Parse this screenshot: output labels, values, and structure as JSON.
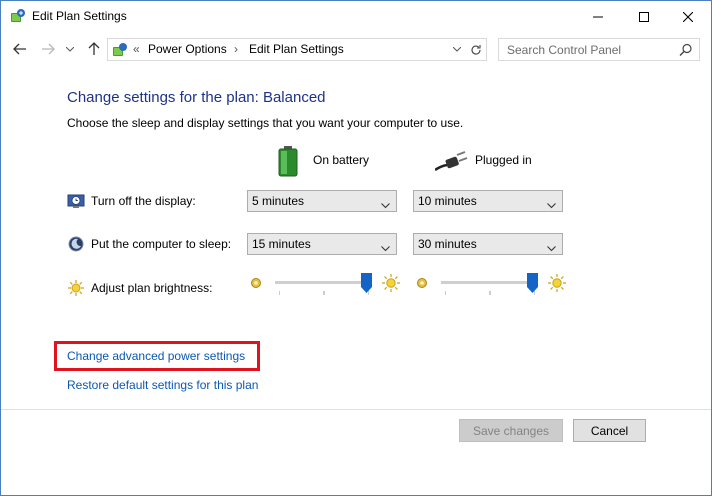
{
  "window": {
    "title": "Edit Plan Settings",
    "controls": {
      "minimize": "—",
      "maximize": "☐",
      "close": "✕"
    }
  },
  "navigation": {
    "breadcrumbs": [
      "«",
      "Power Options",
      "Edit Plan Settings"
    ],
    "chevron": "›",
    "search_placeholder": "Search Control Panel"
  },
  "plan": {
    "title": "Change settings for the plan: Balanced",
    "description": "Choose the sleep and display settings that you want your computer to use."
  },
  "columns": {
    "on_battery": "On battery",
    "plugged_in": "Plugged in"
  },
  "settings": {
    "display": {
      "label": "Turn off the display:",
      "on_battery": "5 minutes",
      "plugged_in": "10 minutes"
    },
    "sleep": {
      "label": "Put the computer to sleep:",
      "on_battery": "15 minutes",
      "plugged_in": "30 minutes"
    },
    "brightness": {
      "label": "Adjust plan brightness:",
      "on_battery_level": 1.0,
      "plugged_in_level": 1.0
    }
  },
  "links": {
    "advanced": "Change advanced power settings",
    "restore": "Restore default settings for this plan"
  },
  "buttons": {
    "save": "Save changes",
    "cancel": "Cancel"
  },
  "colors": {
    "title_blue": "#1e3287",
    "link_blue": "#0b58b3",
    "highlight_red": "#e0141e",
    "slider_thumb": "#1464c8"
  },
  "icons": {
    "window": "power-options-icon",
    "back": "back-arrow-icon",
    "forward": "forward-arrow-icon",
    "up": "up-arrow-icon",
    "refresh": "refresh-icon",
    "search": "search-icon",
    "battery": "battery-icon",
    "plug": "power-plug-icon",
    "display": "display-clock-icon",
    "sleep": "sleep-moon-icon",
    "brightness": "sun-icon"
  }
}
